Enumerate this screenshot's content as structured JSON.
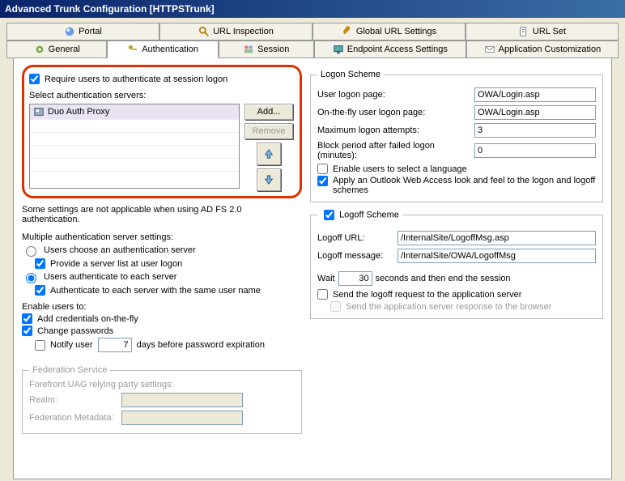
{
  "window_title": "Advanced Trunk Configuration [HTTPSTrunk]",
  "tabs_row1": {
    "portal": "Portal",
    "url_inspection": "URL Inspection",
    "global_url": "Global URL Settings",
    "url_set": "URL Set"
  },
  "tabs_row2": {
    "general": "General",
    "authentication": "Authentication",
    "session": "Session",
    "endpoint": "Endpoint Access Settings",
    "app_custom": "Application Customization"
  },
  "left": {
    "require_auth": "Require users to authenticate at session logon",
    "select_servers": "Select authentication servers:",
    "server0": "Duo Auth Proxy",
    "add_btn": "Add...",
    "remove_btn": "Remove",
    "adfs_note": "Some settings are not applicable when using AD FS 2.0 authentication.",
    "multi_heading": "Multiple authentication server settings:",
    "radio_users_choose": "Users choose an authentication server",
    "provide_list": "Provide a server list at user logon",
    "radio_users_each": "Users authenticate to each server",
    "auth_each_same": "Authenticate to each server with the same user name",
    "enable_users_to": "Enable users to:",
    "add_cred": "Add credentials on-the-fly",
    "change_pw": "Change passwords",
    "notify_user": "Notify user",
    "notify_days_value": "7",
    "notify_days_after": "days before password expiration",
    "fed_legend": "Federation Service",
    "fed_settings": "Forefront UAG relying party settings:",
    "realm": "Realm:",
    "fed_meta": "Federation Metadata:"
  },
  "right": {
    "logon_legend": "Logon Scheme",
    "user_logon_page": "User logon page:",
    "user_logon_val": "OWA/Login.asp",
    "onfly_page": "On-the-fly user logon page:",
    "onfly_val": "OWA/Login.asp",
    "max_attempts": "Maximum logon attempts:",
    "max_attempts_val": "3",
    "block_period": "Block period after failed logon (minutes):",
    "block_period_val": "0",
    "enable_lang": "Enable users to select a language",
    "apply_owa": "Apply an Outlook Web Access look and feel to the logon and logoff schemes",
    "logoff_legend": "Logoff Scheme",
    "logoff_url": "Logoff URL:",
    "logoff_url_val": "/InternalSite/LogoffMsg.asp",
    "logoff_msg": "Logoff message:",
    "logoff_msg_val": "/InternalSite/OWA/LogoffMsg",
    "wait": "Wait",
    "wait_val": "30",
    "wait_after": "seconds and then end the session",
    "send_logoff": "Send the logoff request to the application server",
    "send_app_resp": "Send the application server response to the browser"
  }
}
